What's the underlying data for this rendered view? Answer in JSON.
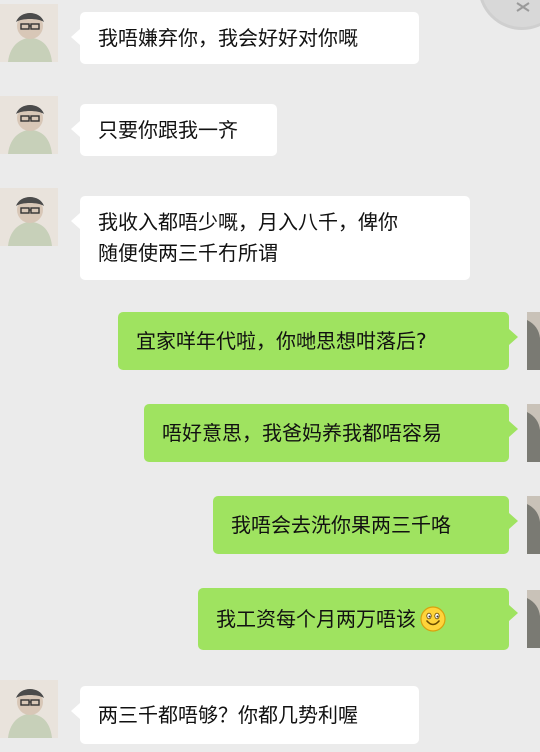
{
  "messages": [
    {
      "side": "left",
      "text": "我唔嫌弃你，我会好好对你嘅"
    },
    {
      "side": "left",
      "text": "只要你跟我一齐"
    },
    {
      "side": "left",
      "lines": [
        "我收入都唔少嘅，月入八千，俾你",
        "随便使两三千冇所谓"
      ]
    },
    {
      "side": "right",
      "text": "宜家咩年代啦，你哋思想咁落后?"
    },
    {
      "side": "right",
      "text": "唔好意思，我爸妈养我都唔容易"
    },
    {
      "side": "right",
      "text": "我唔会去洗你果两三千咯"
    },
    {
      "side": "right",
      "text": "我工资每个月两万唔该"
    },
    {
      "side": "left",
      "text": "两三千都唔够？你都几势利喔"
    }
  ],
  "icons": {
    "emoji": "smile-emoji-icon",
    "corner": "close-icon"
  },
  "colors": {
    "background": "#ebebeb",
    "incoming_bubble": "#ffffff",
    "outgoing_bubble": "#9fe360",
    "text": "#111111"
  }
}
